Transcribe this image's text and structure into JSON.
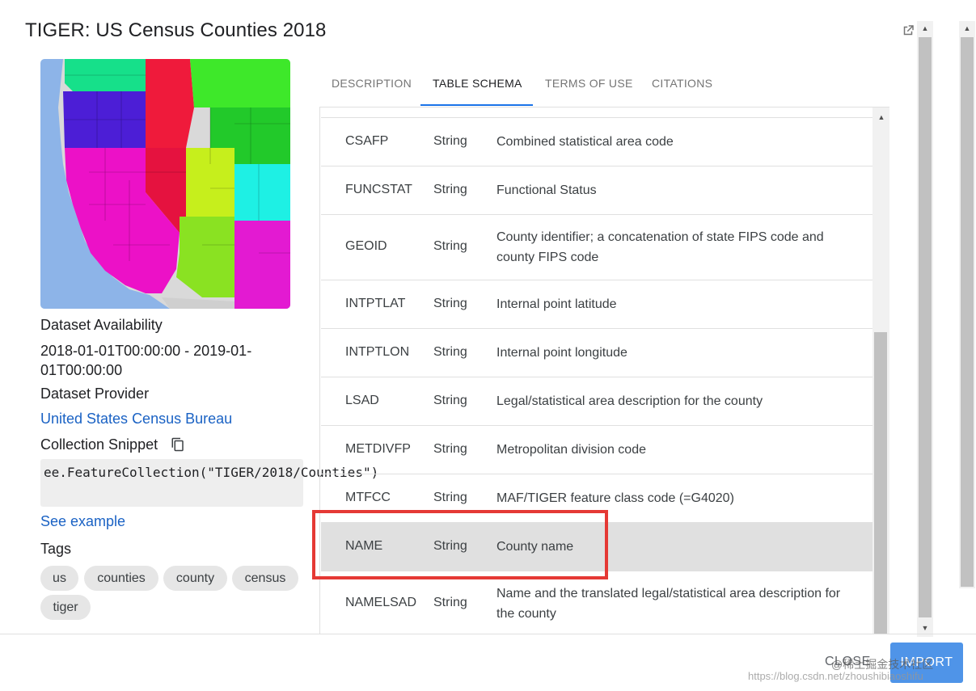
{
  "dialog": {
    "title": "TIGER: US Census Counties 2018",
    "open_external_icon": "open-in-new-icon"
  },
  "left": {
    "availability_label": "Dataset Availability",
    "availability_value": "2018-01-01T00:00:00 - 2019-01-01T00:00:00",
    "provider_label": "Dataset Provider",
    "provider_link": "United States Census Bureau",
    "snippet_label": "Collection Snippet",
    "copy_icon": "content-copy-icon",
    "snippet_code": "ee.FeatureCollection(\"TIGER/2018/Counties\")",
    "see_example": "See example",
    "tags_label": "Tags",
    "tags": [
      "us",
      "counties",
      "county",
      "census",
      "tiger"
    ]
  },
  "tabs": [
    "DESCRIPTION",
    "TABLE SCHEMA",
    "TERMS OF USE",
    "CITATIONS"
  ],
  "active_tab": "TABLE SCHEMA",
  "schema": [
    {
      "name": "CSAFP",
      "type": "String",
      "description": "Combined statistical area code"
    },
    {
      "name": "FUNCSTAT",
      "type": "String",
      "description": "Functional Status"
    },
    {
      "name": "GEOID",
      "type": "String",
      "description": "County identifier; a concatenation of state FIPS code and county FIPS code"
    },
    {
      "name": "INTPTLAT",
      "type": "String",
      "description": "Internal point latitude"
    },
    {
      "name": "INTPTLON",
      "type": "String",
      "description": "Internal point longitude"
    },
    {
      "name": "LSAD",
      "type": "String",
      "description": "Legal/statistical area description for the county"
    },
    {
      "name": "METDIVFP",
      "type": "String",
      "description": "Metropolitan division code"
    },
    {
      "name": "MTFCC",
      "type": "String",
      "description": "MAF/TIGER feature class code (=G4020)"
    },
    {
      "name": "NAME",
      "type": "String",
      "description": "County name"
    },
    {
      "name": "NAMELSAD",
      "type": "String",
      "description": "Name and the translated legal/statistical area description for the county"
    }
  ],
  "highlighted_row": "NAME",
  "footer": {
    "close_label": "CLOSE",
    "import_label": "IMPORT"
  },
  "watermark": {
    "text": "@稀土掘金技术社区",
    "url": "https://blog.csdn.net/zhoushibiaoshifu"
  },
  "colors": {
    "accent": "#1a73e8",
    "link": "#1a62c4",
    "highlight_box": "#e53935",
    "import_button": "#4f94e8"
  }
}
